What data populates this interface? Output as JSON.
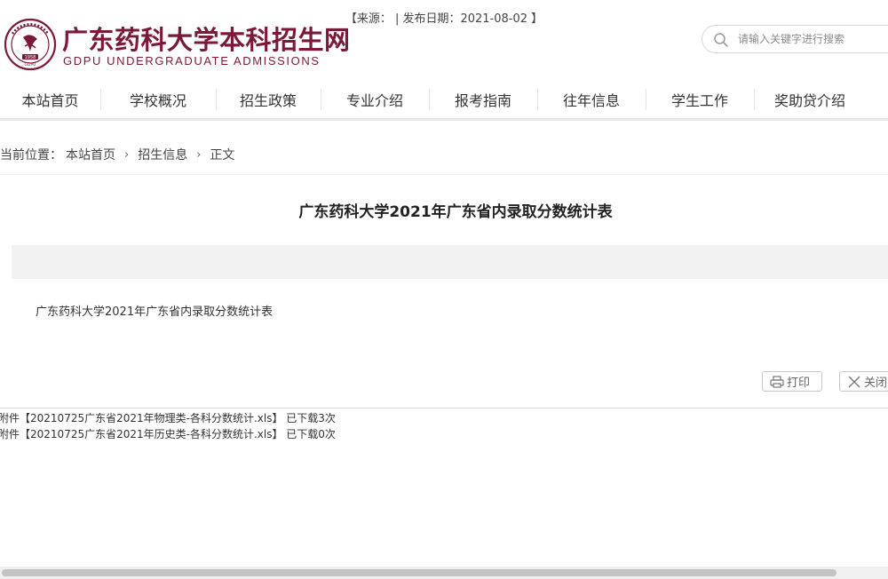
{
  "header": {
    "title": "广东药科大学本科招生网",
    "subtitle": "GDPU UNDERGRADUATE ADMISSIONS",
    "logo_year": "1958",
    "logo_abbr": "GDPU",
    "search_placeholder": "请输入关键字进行搜索"
  },
  "nav": {
    "items": [
      {
        "label": "本站首页"
      },
      {
        "label": "学校概况"
      },
      {
        "label": "招生政策"
      },
      {
        "label": "专业介绍"
      },
      {
        "label": "报考指南"
      },
      {
        "label": "往年信息"
      },
      {
        "label": "学生工作"
      },
      {
        "label": "奖助贷介绍"
      }
    ]
  },
  "breadcrumb": {
    "prefix": "当前位置：",
    "items": [
      "本站首页",
      "招生信息",
      "正文"
    ],
    "separator": "›"
  },
  "article": {
    "title": "广东药科大学2021年广东省内录取分数统计表",
    "meta": "【来源：  | 发布日期：2021-08-02 】",
    "body": "广东药科大学2021年广东省内录取分数统计表"
  },
  "actions": {
    "print_label": "打印",
    "close_label": "关闭"
  },
  "attachments": [
    {
      "prefix": "附件",
      "link": "【20210725广东省2021年物理类-各科分数统计.xls】",
      "downloads": "已下载3次"
    },
    {
      "prefix": "附件",
      "link": "【20210725广东省2021年历史类-各科分数统计.xls】",
      "downloads": "已下载0次"
    }
  ],
  "colors": {
    "brand": "#7a1a36",
    "meta_bar": "#f2f2f2"
  }
}
